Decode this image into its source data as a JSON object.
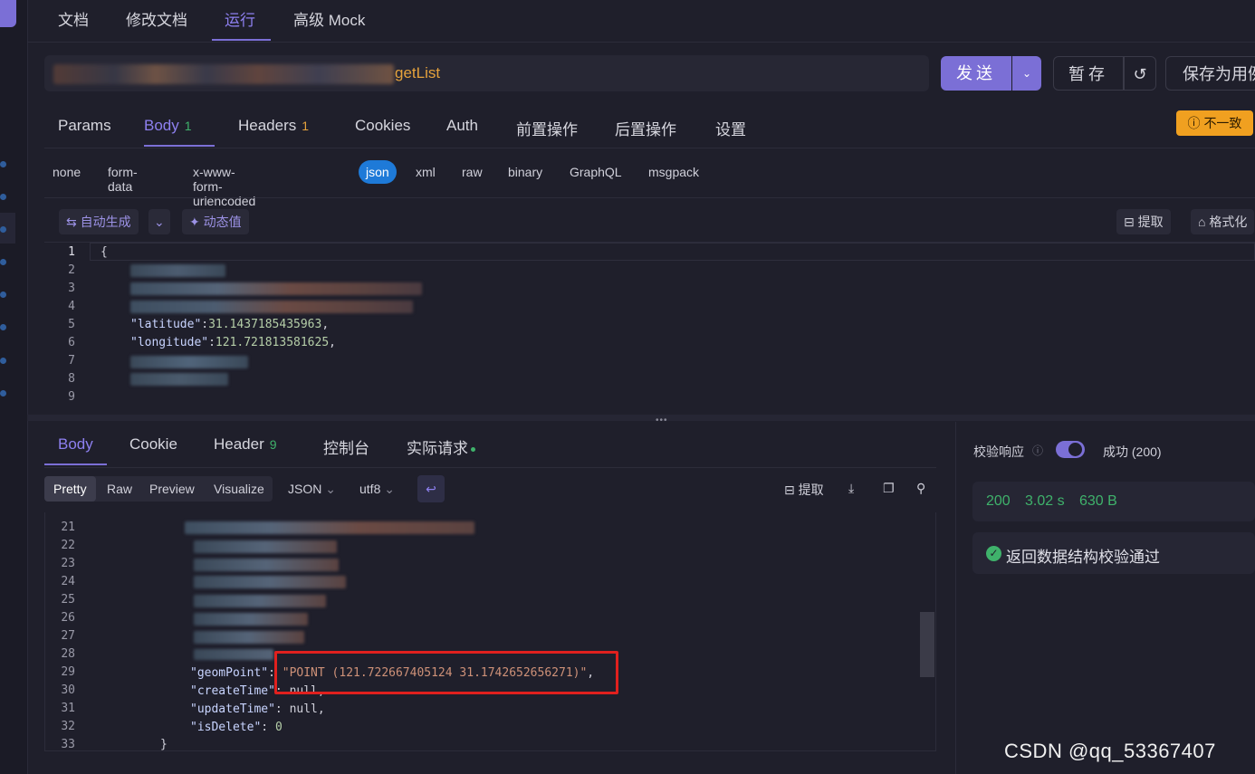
{
  "top_tabs": [
    "文档",
    "修改文档",
    "运行",
    "高级 Mock"
  ],
  "url": {
    "path_visible": "getList"
  },
  "actions": {
    "send": "发送",
    "save_temp": "暂存",
    "save_as_case": "保存为用例"
  },
  "request_tabs": {
    "params": "Params",
    "body": "Body",
    "body_count": "1",
    "headers": "Headers",
    "headers_count": "1",
    "cookies": "Cookies",
    "auth": "Auth",
    "pre": "前置操作",
    "post": "后置操作",
    "settings": "设置"
  },
  "mismatch_badge": "不一致",
  "body_types": [
    "none",
    "form-data",
    "x-www-form-urlencoded",
    "json",
    "xml",
    "raw",
    "binary",
    "GraphQL",
    "msgpack"
  ],
  "editor_tools": {
    "auto_gen": "自动生成",
    "dynamic": "动态值",
    "extract": "提取",
    "format": "格式化"
  },
  "request_body": {
    "line_numbers": [
      "1",
      "2",
      "3",
      "4",
      "5",
      "6",
      "7",
      "8",
      "9"
    ],
    "open_brace": "{",
    "lat_key": "\"latitude\"",
    "lat_val": "31.1437185435963",
    "lng_key": "\"longitude\"",
    "lng_val": "121.721813581625"
  },
  "response_tabs": {
    "body": "Body",
    "cookie": "Cookie",
    "header": "Header",
    "header_count": "9",
    "console": "控制台",
    "actual": "实际请求"
  },
  "response_tools": {
    "pretty": "Pretty",
    "raw": "Raw",
    "preview": "Preview",
    "visualize": "Visualize",
    "lang": "JSON",
    "encoding": "utf8",
    "extract": "提取"
  },
  "response_body": {
    "line_numbers": [
      "21",
      "22",
      "23",
      "24",
      "25",
      "26",
      "27",
      "28",
      "29",
      "30",
      "31",
      "32",
      "33"
    ],
    "geom_key": "\"geomPoint\"",
    "geom_val": "\"POINT (121.722667405124 31.1742652656271)\"",
    "create_key": "\"createTime\"",
    "update_key": "\"updateTime\"",
    "delete_key": "\"isDelete\"",
    "null_val": "null",
    "zero_val": "0",
    "close_brace": "}"
  },
  "validation": {
    "label": "校验响应",
    "result": "成功 (200)",
    "status": "200",
    "time": "3.02 s",
    "size": "630 B",
    "message": "返回数据结构校验通过"
  },
  "watermark": "CSDN @qq_53367407",
  "colors": {
    "accent": "#7b6fd6",
    "warning": "#f0a020",
    "success": "#3fb26b",
    "highlight_box": "#e0201e"
  }
}
